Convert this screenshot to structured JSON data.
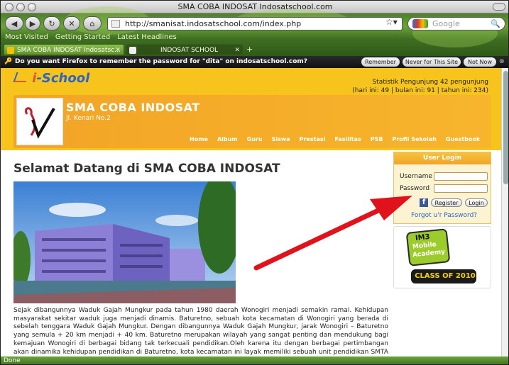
{
  "window": {
    "title": "SMA COBA INDOSAT Indosatschool.com"
  },
  "toolbar": {
    "url": "http://smanisat.indosatschool.com/index.php",
    "search_placeholder": "Google"
  },
  "bookmarks": [
    "Most Visited",
    "Getting Started",
    "Latest Headlines"
  ],
  "tabs": [
    {
      "label": "SMA COBA INDOSAT Indosatsc..."
    },
    {
      "label": "INDOSAT SCHOOL"
    }
  ],
  "password_bar": {
    "message": "Do you want Firefox to remember the password for \"dita\" on indosatschool.com?",
    "remember": "Remember",
    "never": "Never for This Site",
    "not_now": "Not Now"
  },
  "header": {
    "logo_i": "i",
    "logo_rest": "-School",
    "stats_line1": "Statistik Pengunjung 42 pengunjung",
    "stats_line2": "(hari ini: 49 | bulan ini: 91 | tahun ini: 234)",
    "school_name": "SMA COBA INDOSAT",
    "address": "Jl. Kenari No.2",
    "menu": [
      "Home",
      "Album",
      "Guru",
      "Siswa",
      "Prestasi",
      "Fasilitas",
      "PSB",
      "Profil Sekolah",
      "Guestbook"
    ]
  },
  "main": {
    "title": "Selamat Datang di SMA COBA INDOSAT",
    "paragraph": "Sejak dibangunnya Waduk Gajah Mungkur pada tahun 1980 daerah Wonogiri menjadi semakin ramai. Kehidupan masyarakat sekitar waduk juga menjadi dinamis. Baturetno, sebuah kota kecamatan di Wonogiri yang berada di sebelah tenggara Waduk Gajah Mungkur. Dengan dibangunnya Waduk Gajah Mungkur, jarak Wonogiri – Baturetno yang semula + 20 km menjadi + 40 km. Baturetno merupakan wilayah yang sangat penting dan mendukung bagi kemajuan Wonogiri di berbagai bidang tak terkecuali pendidikan.Oleh karena itu dengan berbagai pertimbangan akan dinamika kehidupan pendidikan di Baturetno, kota kecamatan ini layak memiliki sebuah unit pendidikan SMTA negeri"
  },
  "login": {
    "title": "User Login",
    "username_label": "Username",
    "password_label": "Password",
    "register": "Register",
    "login": "Login",
    "forgot": "Forgot u'r Password?"
  },
  "ad": {
    "line1": "IM3",
    "line2": "Mobile",
    "line3": "Academy",
    "line4": "CLASS OF 2010"
  },
  "status": "Done",
  "colors": {
    "header_yellow": "#f6c41c",
    "banner_orange": "#f2a426",
    "arrow_red": "#e0121b",
    "chrome_green": "#4d7f2a"
  }
}
